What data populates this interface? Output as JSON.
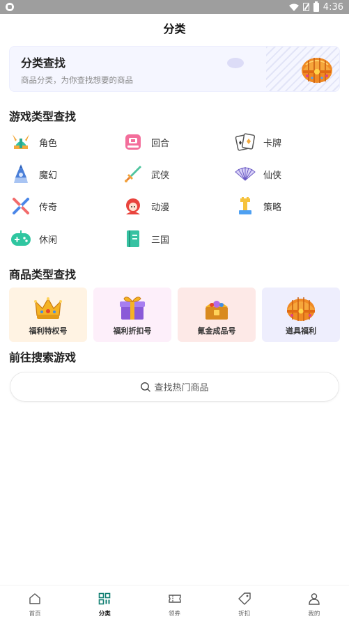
{
  "status_bar": {
    "time": "4:36"
  },
  "header": {
    "title": "分类"
  },
  "banner": {
    "title": "分类查找",
    "subtitle": "商品分类，为你查找想要的商品"
  },
  "game_types": {
    "title": "游戏类型查找",
    "items": [
      {
        "label": "角色",
        "icon": "viking-helmet-icon"
      },
      {
        "label": "回合",
        "icon": "turn-icon"
      },
      {
        "label": "卡牌",
        "icon": "cards-icon"
      },
      {
        "label": "魔幻",
        "icon": "wizard-icon"
      },
      {
        "label": "武侠",
        "icon": "sword-icon"
      },
      {
        "label": "仙侠",
        "icon": "fan-icon"
      },
      {
        "label": "传奇",
        "icon": "crossed-swords-icon"
      },
      {
        "label": "动漫",
        "icon": "anime-girl-icon"
      },
      {
        "label": "策略",
        "icon": "tower-icon"
      },
      {
        "label": "休闲",
        "icon": "gamepad-icon"
      },
      {
        "label": "三国",
        "icon": "book-icon"
      }
    ]
  },
  "goods_types": {
    "title": "商品类型查找",
    "items": [
      {
        "label": "福利特权号",
        "icon": "crown-icon",
        "bg": "#fff3e3"
      },
      {
        "label": "福利折扣号",
        "icon": "gift-box-icon",
        "bg": "#fdeffa"
      },
      {
        "label": "氪金成品号",
        "icon": "treasure-chest-icon",
        "bg": "#fde9e7"
      },
      {
        "label": "道具福利",
        "icon": "jeweled-chest-icon",
        "bg": "#eeeefd"
      }
    ]
  },
  "search": {
    "title": "前往搜索游戏",
    "placeholder": "查找热门商品"
  },
  "bottom_nav": {
    "items": [
      {
        "label": "首页",
        "icon": "home-icon"
      },
      {
        "label": "分类",
        "icon": "category-icon"
      },
      {
        "label": "领券",
        "icon": "coupon-icon"
      },
      {
        "label": "折扣",
        "icon": "tag-icon"
      },
      {
        "label": "我的",
        "icon": "user-icon"
      }
    ],
    "active": "分类"
  },
  "colors": {
    "accent": "#0e9a88",
    "banner_bg": "#f5f6ff"
  }
}
